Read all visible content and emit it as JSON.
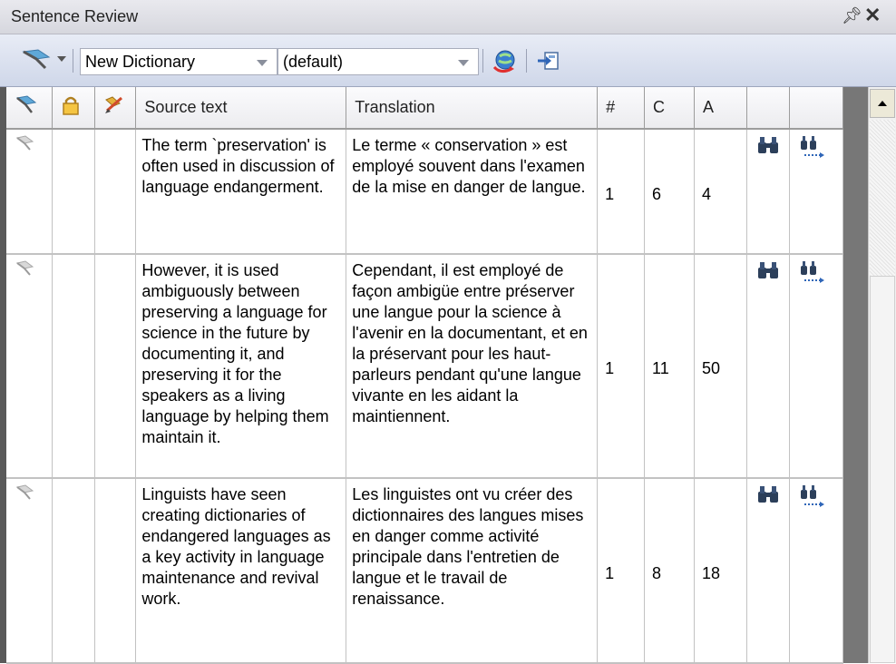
{
  "panel": {
    "title": "Sentence Review"
  },
  "toolbar": {
    "dictionary_value": "New Dictionary",
    "profile_value": "(default)"
  },
  "table": {
    "columns": [
      "Source text",
      "Translation",
      "#",
      "C",
      "A"
    ],
    "rows": [
      {
        "source": "The term `preservation' is often used in discussion of language endangerment.",
        "translation": "Le terme « conservation » est employé souvent dans l'examen de la mise en danger de langue.",
        "num": "1",
        "c": "6",
        "a": "4"
      },
      {
        "source": "However, it is used ambiguously between preserving a language for science in the future by documenting it, and preserving it for the speakers as a living language by helping them maintain it.",
        "translation": "Cependant, il est employé de façon ambigüe entre préserver une langue pour la science à l'avenir en la documentant, et en la préservant pour les haut-parleurs pendant qu'une langue vivante en les aidant la maintiennent.",
        "num": "1",
        "c": "11",
        "a": "50"
      },
      {
        "source": "Linguists have seen creating dictionaries of endangered languages as a key activity in language maintenance and revival work.",
        "translation": "Les linguistes ont vu créer des dictionnaires des langues mises en danger comme activité principale dans l'entretien de langue et le travail de renaissance.",
        "num": "1",
        "c": "8",
        "a": "18"
      }
    ]
  },
  "icons": {
    "flag": "flag-icon",
    "lock": "lock-icon",
    "pencil": "pencil-flag-icon",
    "find": "binoculars-icon",
    "find_next": "find-next-icon",
    "translate": "globe-translate-icon",
    "export": "export-icon"
  }
}
